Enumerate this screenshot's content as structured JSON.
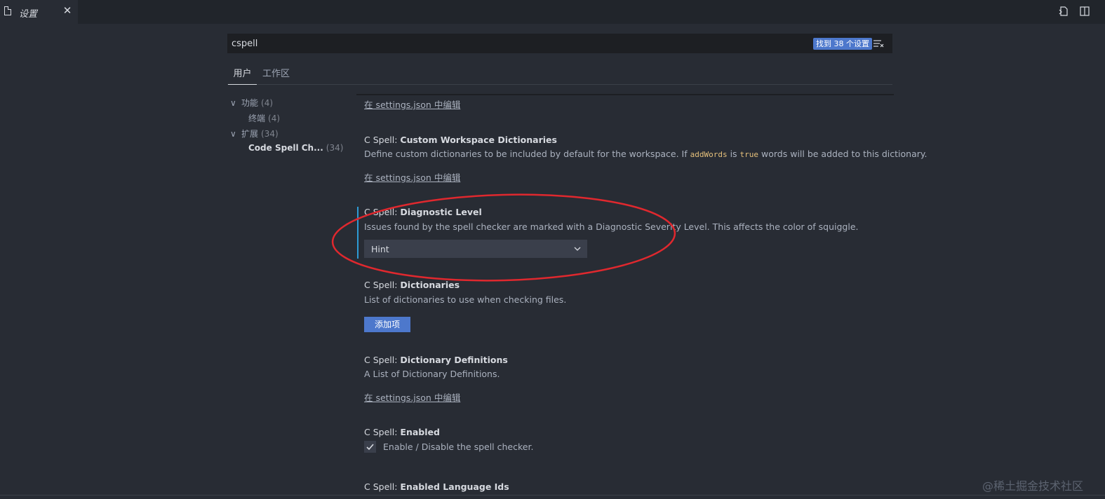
{
  "tab": {
    "title": "设置",
    "close": "✕"
  },
  "search": {
    "value": "cspell",
    "result_count": "找到 38 个设置"
  },
  "scope_tabs": {
    "user": "用户",
    "workspace": "工作区"
  },
  "toc": [
    {
      "label": "功能",
      "count": "(4)",
      "expanded": true
    },
    {
      "label": "终端",
      "count": "(4)"
    },
    {
      "label": "扩展",
      "count": "(34)",
      "expanded": true
    },
    {
      "label": "Code Spell Ch...",
      "count": "(34)",
      "selected": true
    }
  ],
  "edit_link": "在 settings.json 中编辑",
  "settings": {
    "custom_ws_dicts": {
      "category": "C Spell: ",
      "name": "Custom Workspace Dictionaries",
      "desc_before": "Define custom dictionaries to be included by default for the workspace. If ",
      "code1": "addWords",
      "desc_mid": " is ",
      "code2": "true",
      "desc_after": " words will be added to this dictionary."
    },
    "diagnostic_level": {
      "category": "C Spell: ",
      "name": "Diagnostic Level",
      "desc": "Issues found by the spell checker are marked with a Diagnostic Severity Level. This affects the color of squiggle.",
      "value": "Hint"
    },
    "dictionaries": {
      "category": "C Spell: ",
      "name": "Dictionaries",
      "desc": "List of dictionaries to use when checking files.",
      "add_button": "添加项"
    },
    "dictionary_definitions": {
      "category": "C Spell: ",
      "name": "Dictionary Definitions",
      "desc": "A List of Dictionary Definitions."
    },
    "enabled": {
      "category": "C Spell: ",
      "name": "Enabled",
      "checkbox_label": "Enable / Disable the spell checker.",
      "checked": true
    },
    "enabled_language_ids": {
      "category": "C Spell: ",
      "name": "Enabled Language Ids"
    }
  },
  "watermark": "@稀土掘金技术社区",
  "colors": {
    "accent": "#4d78cc",
    "focus": "#2d9bd5",
    "annotation": "#e0282e",
    "background": "#282c34"
  }
}
